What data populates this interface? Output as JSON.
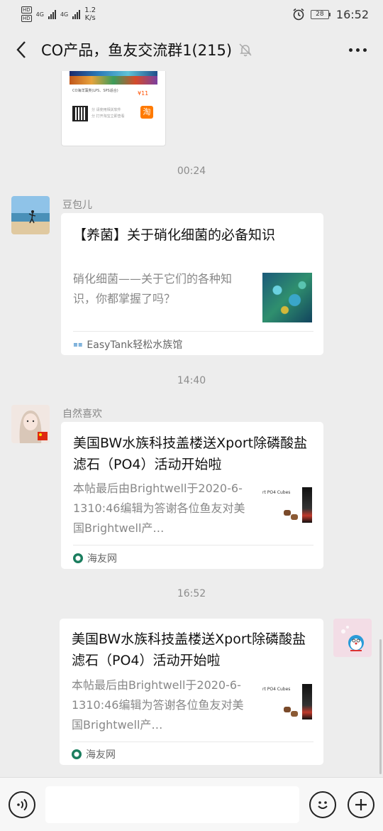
{
  "status_bar": {
    "hd1": "HD",
    "hd2": "HD",
    "net1": "4G",
    "net2": "4G",
    "speed_value": "1.2",
    "speed_unit": "K/s",
    "battery": "28",
    "time": "16:52"
  },
  "header": {
    "title": "CO产品，鱼友交流群1(215)"
  },
  "messages": {
    "partial_card": {
      "text": "CO海洋藻类(LPS、SPS适合)",
      "price": "¥11",
      "small_line1": "分 请使用相关软件",
      "small_line2": "分 打开淘宝立即查看",
      "taobao_badge": "淘"
    },
    "time1": "00:24",
    "msg1": {
      "sender": "豆包儿",
      "title": "【养菌】关于硝化细菌的必备知识",
      "desc": "硝化细菌——关于它们的各种知识，你都掌握了吗？",
      "source": "EasyTank轻松水族馆"
    },
    "time2": "14:40",
    "msg2": {
      "sender": "自然喜欢",
      "title": "美国BW水族科技盖楼送Xport除磷酸盐滤石（PO4）活动开始啦",
      "desc": "本帖最后由Brightwell于2020-6-1310:46编辑为答谢各位鱼友对美国Brightwell产…",
      "thumb_label": "rt PO4 Cubes",
      "source": "海友网"
    },
    "time3": "16:52",
    "msg3": {
      "title": "美国BW水族科技盖楼送Xport除磷酸盐滤石（PO4）活动开始啦",
      "desc": "本帖最后由Brightwell于2020-6-1310:46编辑为答谢各位鱼友对美国Brightwell产…",
      "thumb_label": "rt PO4 Cubes",
      "source": "海友网"
    }
  },
  "colors": {
    "background": "#ededed",
    "card": "#ffffff",
    "muted_text": "#888888",
    "taobao": "#ff7a00"
  }
}
